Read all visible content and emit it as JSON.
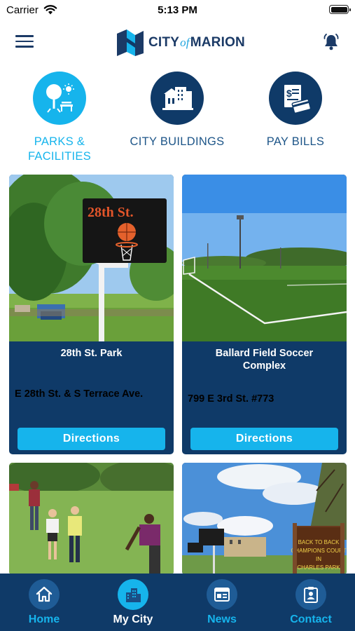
{
  "status_bar": {
    "carrier": "Carrier",
    "time": "5:13 PM"
  },
  "header": {
    "logo": {
      "city": "CITY",
      "of": "of",
      "name": "MARION"
    },
    "menu_icon": "hamburger-menu-icon",
    "bell_icon": "bell-icon"
  },
  "categories": [
    {
      "label_line1": "PARKS &",
      "label_line2": "FACILITIES",
      "icon": "park-icon",
      "active": true
    },
    {
      "label": "CITY BUILDINGS",
      "icon": "building-icon",
      "active": false
    },
    {
      "label": "PAY BILLS",
      "icon": "bill-icon",
      "active": false
    }
  ],
  "locations": [
    {
      "name": "28th St. Park",
      "address": "E 28th St. & S Terrace Ave.",
      "button": "Directions",
      "sign_text": "28th St."
    },
    {
      "name_line1": "Ballard Field Soccer",
      "name_line2": "Complex",
      "address": "799 E 3rd St. #773",
      "button": "Directions"
    },
    {
      "name": ""
    },
    {
      "sign_lines": [
        "BACK TO BACK",
        "CHAMPIONS COURT",
        "IN",
        "CHARLES PARK"
      ]
    }
  ],
  "tabs": [
    {
      "label": "Home",
      "icon": "home-icon",
      "active": false
    },
    {
      "label": "My City",
      "icon": "city-icon",
      "active": true
    },
    {
      "label": "News",
      "icon": "news-icon",
      "active": false
    },
    {
      "label": "Contact",
      "icon": "contact-icon",
      "active": false
    }
  ],
  "colors": {
    "navy": "#0f3a68",
    "accent_blue": "#16b4ec",
    "tab_circle": "#1f5c96",
    "logo_navy": "#1b3a66"
  }
}
